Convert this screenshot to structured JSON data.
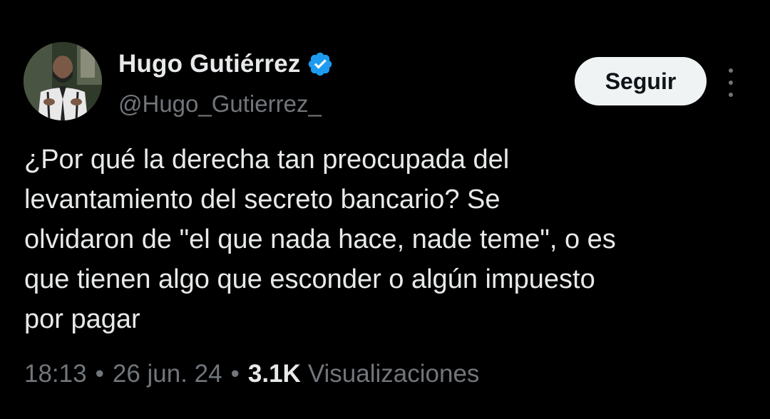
{
  "author": {
    "display_name": "Hugo Gutiérrez",
    "handle": "@Hugo_Gutierrez_",
    "verified": true,
    "verified_color": "#1d9bf0"
  },
  "actions": {
    "follow_label": "Seguir",
    "more_icon": "more-vertical-icon"
  },
  "tweet": {
    "text_lines": [
      "¿Por qué la derecha tan preocupada del",
      "levantamiento del secreto bancario? Se",
      "olvidaron de \"el que nada hace, nade teme\", o es",
      "que tienen algo que esconder o algún impuesto",
      "por pagar"
    ]
  },
  "meta": {
    "time": "18:13",
    "separator": "•",
    "date": "26 jun. 24",
    "views_count": "3.1K",
    "views_label": "Visualizaciones"
  },
  "colors": {
    "background": "#000000",
    "text_primary": "#e7e9ea",
    "text_secondary": "#71767b",
    "button_bg": "#eff3f4",
    "button_text": "#0f1419"
  }
}
